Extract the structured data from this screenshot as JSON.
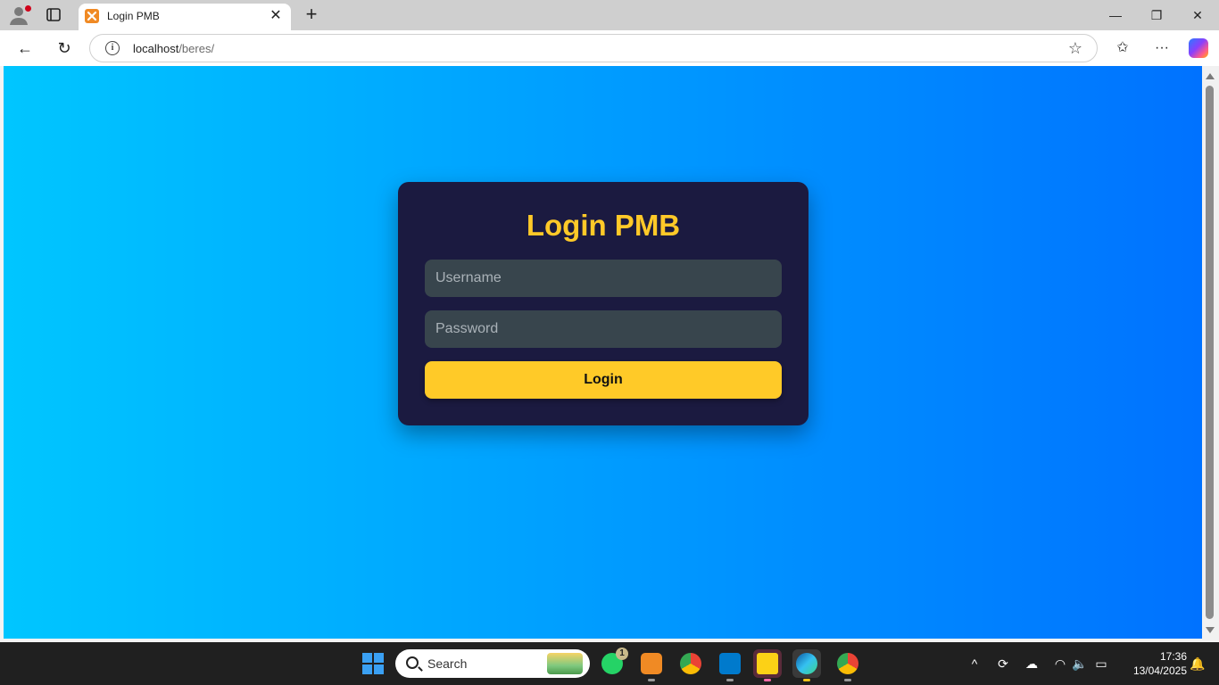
{
  "browser": {
    "tab": {
      "title": "Login PMB",
      "close_glyph": "✕"
    },
    "new_tab_glyph": "+",
    "window_controls": {
      "minimize": "—",
      "restore": "❐",
      "close": "✕"
    },
    "address": {
      "host": "localhost",
      "path": "/beres/"
    },
    "icons": {
      "back": "←",
      "refresh": "↻",
      "star": "☆",
      "favorites": "✩",
      "more": "···"
    }
  },
  "login": {
    "title": "Login PMB",
    "username_placeholder": "Username",
    "password_placeholder": "Password",
    "button_label": "Login",
    "colors": {
      "card": "#1b1a40",
      "accent": "#ffca28",
      "input": "#38454d",
      "bg_start": "#00c6ff",
      "bg_end": "#0072ff"
    }
  },
  "taskbar": {
    "search_text": "Search",
    "whatsapp_badge": "1",
    "time": "17:36",
    "date": "13/04/2025",
    "apps": [
      "whatsapp-icon",
      "xampp-icon",
      "chrome-icon",
      "vscode-icon",
      "sticky-notes-icon",
      "edge-icon",
      "chrome-profile-icon"
    ],
    "tray_icons": {
      "overflow": "^",
      "sync": "⟳",
      "cloud": "☁",
      "wifi": "◠",
      "volume": "🔈",
      "battery": "▭",
      "notifications": "🔔"
    }
  }
}
